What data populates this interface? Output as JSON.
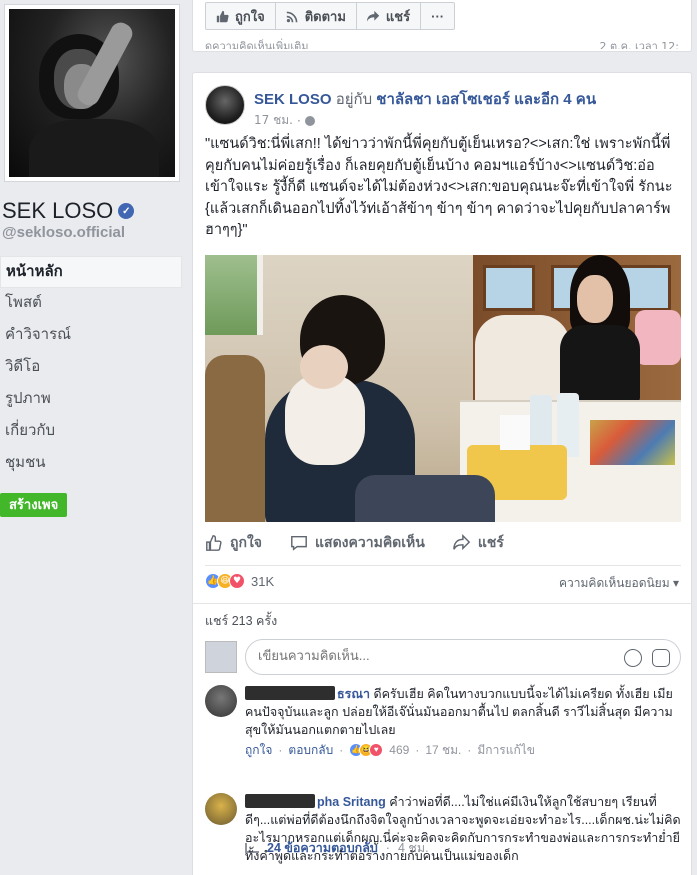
{
  "top_card": {
    "like_label": "ถูกใจ",
    "follow_label": "ติดตาม",
    "share_label": "แชร์",
    "more_label": "···",
    "cut_text": "ดูความคิดเห็นเพิ่มเติม",
    "cut_time": "2 ต.ค. เวลา 12:"
  },
  "sidebar": {
    "page_name": "SEK LOSO",
    "verified_mark": "✓",
    "handle": "@sekloso.official",
    "items": [
      {
        "label": "หน้าหลัก",
        "active": true
      },
      {
        "label": "โพสต์"
      },
      {
        "label": "คำวิจารณ์"
      },
      {
        "label": "วิดีโอ"
      },
      {
        "label": "รูปภาพ"
      },
      {
        "label": "เกี่ยวกับ"
      },
      {
        "label": "ชุมชน"
      }
    ],
    "create_page": "สร้างเพจ"
  },
  "post": {
    "author": "SEK LOSO",
    "with_prefix": "อยู่กับ",
    "with_name": "ชาลัลชา เอสโซเชอร์",
    "and_more": "และอีก 4 คน",
    "time": "17 ชม.",
    "text": "\"แซนด์วิช:นี่พี่เสก!! ได้ข่าวว่าพักนี้พี่คุยกับตู้เย็นเหรอ?<>เสก:ใช่ เพราะพักนี้พี่คุยกับคนไม่ค่อยรู้เรื่อง ก็เลยคุยกับตู้เย็นบ้าง คอมฯแอร์บ้าง<>แซนด์วิช:อ่อ เข้าใจแระ รู้งี้ก็ดี แซนด์จะได้ไม่ต้องห่วง<>เสก:ขอบคุณนะจ๊ะที่เข้าใจพี่ รักนะ {แล้วเสกก็เดินออกไปทิ้งไว้ท่เอ้าส้ข้าๆ ข้าๆ ข้าๆ คาดว่าจะไปคุยกับปลาคาร์พ ฮาๆๆ}\"",
    "actions": {
      "like": "ถูกใจ",
      "comment": "แสดงความคิดเห็น",
      "share": "แชร์"
    },
    "reaction_count": "31K",
    "top_comments": "ความคิดเห็นยอดนิยม",
    "shares": "แชร์ 213 ครั้ง",
    "composer_placeholder": "เขียนความคิดเห็น..."
  },
  "comments": [
    {
      "name": "ธรณา",
      "text": "ดีครับเฮีย คิดในทางบวกแบบนี้จะได้ไม่เครียด ทั้งเฮีย เมียคนปัจจุบันและลูก ปล่อยให้อีเจ๊นั่นมันออกมาตื้นไป ตลกสิ้นดี ราวีไม่สิ้นสุด มีความสุขให้มันนอกแตกตายไปเลย",
      "like": "ถูกใจ",
      "reply": "ตอบกลับ",
      "count": "469",
      "time": "17 ชม.",
      "edited": "มีการแก้ไข"
    },
    {
      "name": "pha Sritang",
      "text": "คำว่าพ่อที่ดี....ไม่ใช่แค่มีเงินให้ลูกใช้สบายๆ เรียนที่ดีๆ...แต่พ่อที่ดีต้องนึกถึงจิตใจลูกบ้างเวลาจะพูดจะเอ่ยจะทำอะไร....เด็กผช.น่ะไม่คิดอะไรมากหรอกแต่เด็กผญ.นี่ค่ะจะคิดจะคิดกับการกระทำของพ่อและการกระทำย่ำยีทั้งคำพูดและกระทำต่อร่างกายกับคนเป็นแม่ของเด็ก"
    }
  ],
  "replies": {
    "label": "24 ข้อความตอบกลับ",
    "time": "4 ชม."
  }
}
